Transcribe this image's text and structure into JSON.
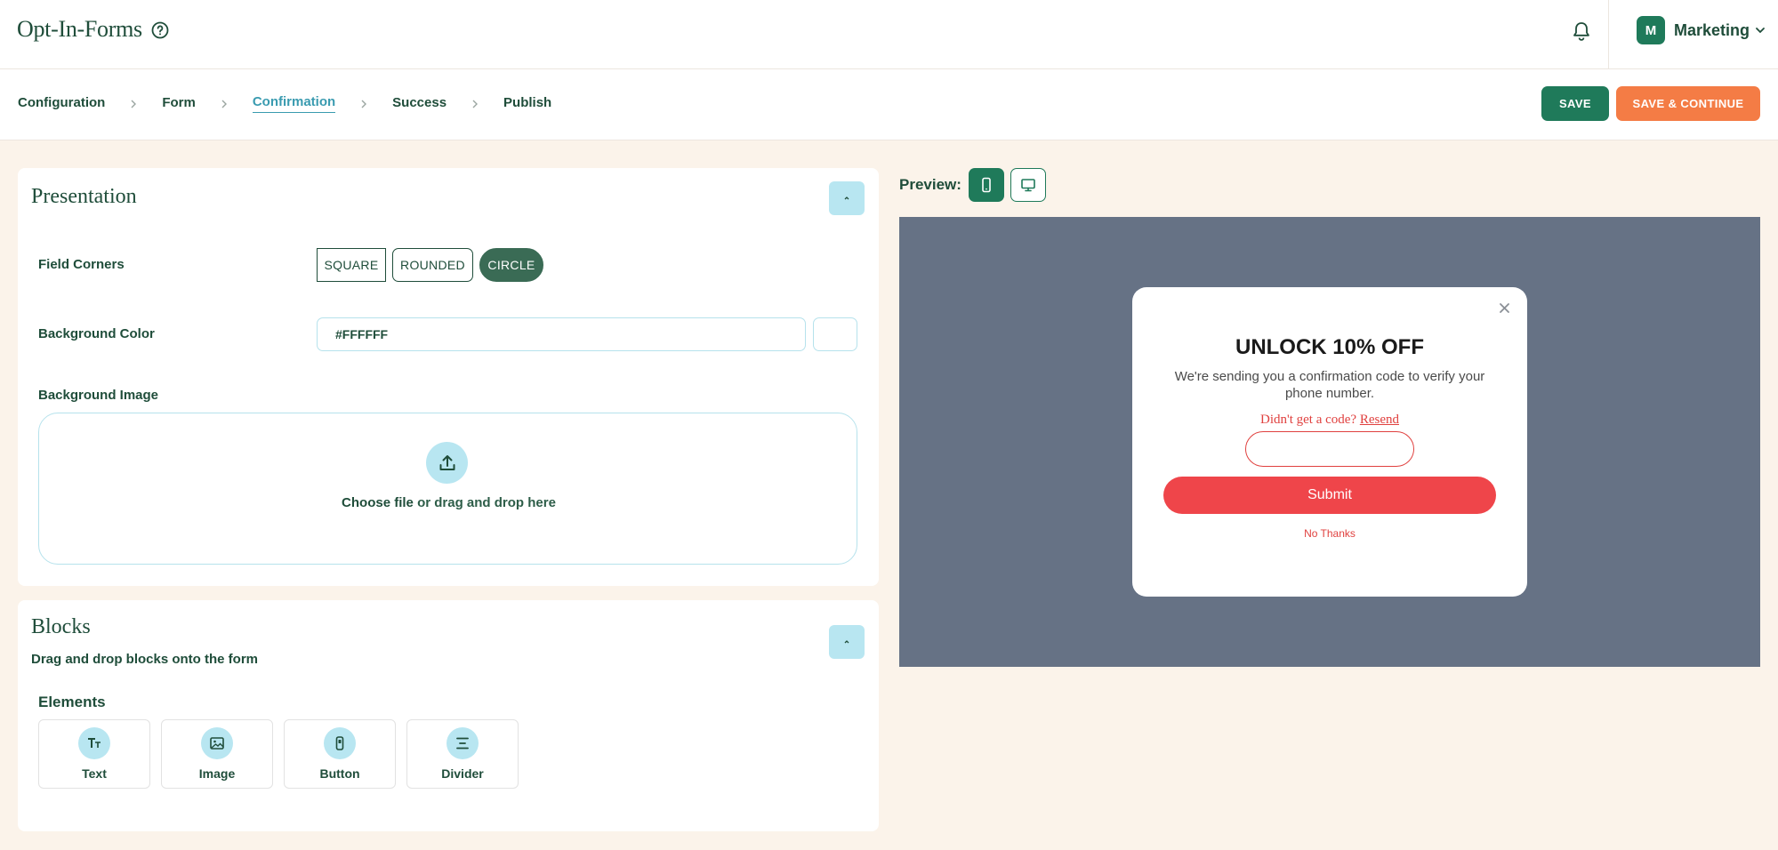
{
  "header": {
    "app_title": "Opt-In-Forms",
    "account": {
      "avatar_initial": "M",
      "name": "Marketing"
    }
  },
  "steps": [
    {
      "label": "Configuration",
      "active": false
    },
    {
      "label": "Form",
      "active": false
    },
    {
      "label": "Confirmation",
      "active": true
    },
    {
      "label": "Success",
      "active": false
    },
    {
      "label": "Publish",
      "active": false
    }
  ],
  "toolbar": {
    "save_label": "SAVE",
    "save_continue_label": "SAVE & CONTINUE"
  },
  "presentation": {
    "title": "Presentation",
    "field_corners": {
      "label": "Field Corners",
      "options": [
        "SQUARE",
        "ROUNDED",
        "CIRCLE"
      ],
      "selected": "CIRCLE"
    },
    "background_color": {
      "label": "Background Color",
      "value": "#FFFFFF"
    },
    "background_image": {
      "label": "Background Image",
      "choose_text": "Choose file",
      "drop_text": " or drag and drop here"
    }
  },
  "blocks": {
    "title": "Blocks",
    "subtitle": "Drag and drop blocks onto the form",
    "elements_heading": "Elements",
    "elements": [
      {
        "label": "Text",
        "icon": "text-icon"
      },
      {
        "label": "Image",
        "icon": "image-icon"
      },
      {
        "label": "Button",
        "icon": "button-icon"
      },
      {
        "label": "Divider",
        "icon": "divider-icon"
      }
    ]
  },
  "preview": {
    "label": "Preview:",
    "selected_device": "mobile",
    "popup": {
      "heading": "UNLOCK 10% OFF",
      "body": "We're sending you a confirmation code to verify your phone number.",
      "resend_prompt": "Didn't get a code?",
      "resend_link": "Resend",
      "submit_label": "Submit",
      "decline_label": "No Thanks"
    }
  },
  "colors": {
    "brand_green": "#1f7a5a",
    "accent_orange": "#f47c45",
    "popup_red": "#ef454a",
    "page_background": "#fbf3ea",
    "stage_background": "#667285"
  }
}
